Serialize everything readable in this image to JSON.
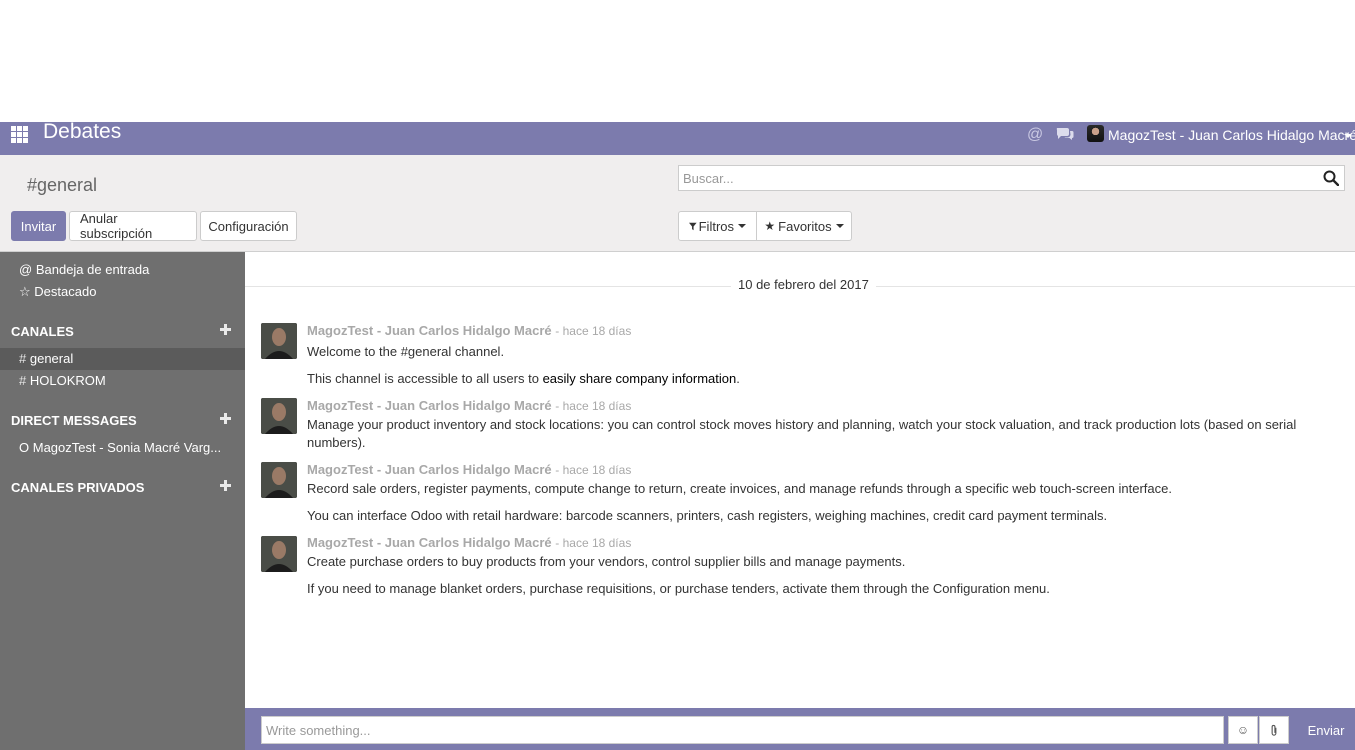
{
  "navbar": {
    "app_title": "Debates",
    "user_name": "MagozTest - Juan Carlos Hidalgo Macré",
    "apps_icon": "apps-grid-icon",
    "mention_icon": "at-icon",
    "chat_icon": "chat-icon"
  },
  "control_panel": {
    "breadcrumb": "#general",
    "search_placeholder": "Buscar...",
    "buttons": {
      "invite": "Invitar",
      "unsubscribe": "Anular subscripción",
      "settings": "Configuración"
    },
    "filters_label": "Filtros",
    "favorites_label": "Favoritos"
  },
  "sidebar": {
    "inbox": "Bandeja de entrada",
    "starred": "Destacado",
    "channels_heading": "CANALES",
    "channels": [
      {
        "prefix": "#",
        "name": "general"
      },
      {
        "prefix": "#",
        "name": "HOLOKROM"
      }
    ],
    "dm_heading": "DIRECT MESSAGES",
    "direct_messages": [
      {
        "prefix": "O",
        "name": "MagozTest - Sonia Macré Varg..."
      }
    ],
    "private_heading": "CANALES PRIVADOS"
  },
  "thread": {
    "date_separator": "10 de febrero del 2017",
    "messages": [
      {
        "author": "MagozTest - Juan Carlos Hidalgo Macré",
        "time": "- hace 18 días",
        "lines": [
          "Welcome to the #general channel."
        ],
        "extra_prefix": "This channel is accessible to all users to ",
        "extra_bold": "easily share company information",
        "extra_suffix": "."
      },
      {
        "author": "MagozTest - Juan Carlos Hidalgo Macré",
        "time": "- hace 18 días",
        "lines": [
          "Manage your product inventory and stock locations: you can control stock moves history and planning, watch your stock valuation, and track production lots (based on serial numbers)."
        ]
      },
      {
        "author": "MagozTest - Juan Carlos Hidalgo Macré",
        "time": "- hace 18 días",
        "lines": [
          "Record sale orders, register payments, compute change to return, create invoices, and manage refunds through a specific web touch-screen interface.",
          "You can interface Odoo with retail hardware: barcode scanners, printers, cash registers, weighing machines, credit card payment terminals."
        ]
      },
      {
        "author": "MagozTest - Juan Carlos Hidalgo Macré",
        "time": "- hace 18 días",
        "lines": [
          "Create purchase orders to buy products from your vendors, control supplier bills and manage payments.",
          "If you need to manage blanket orders, purchase requisitions, or purchase tenders, activate them through the Configuration menu."
        ]
      }
    ]
  },
  "composer": {
    "placeholder": "Write something...",
    "emoji_icon": "smiley-icon",
    "attach_icon": "paperclip-icon",
    "send_label": "Enviar"
  },
  "colors": {
    "brand": "#7c7bad",
    "sidebar": "#6f6f6f",
    "control_panel": "#f0eeee"
  }
}
